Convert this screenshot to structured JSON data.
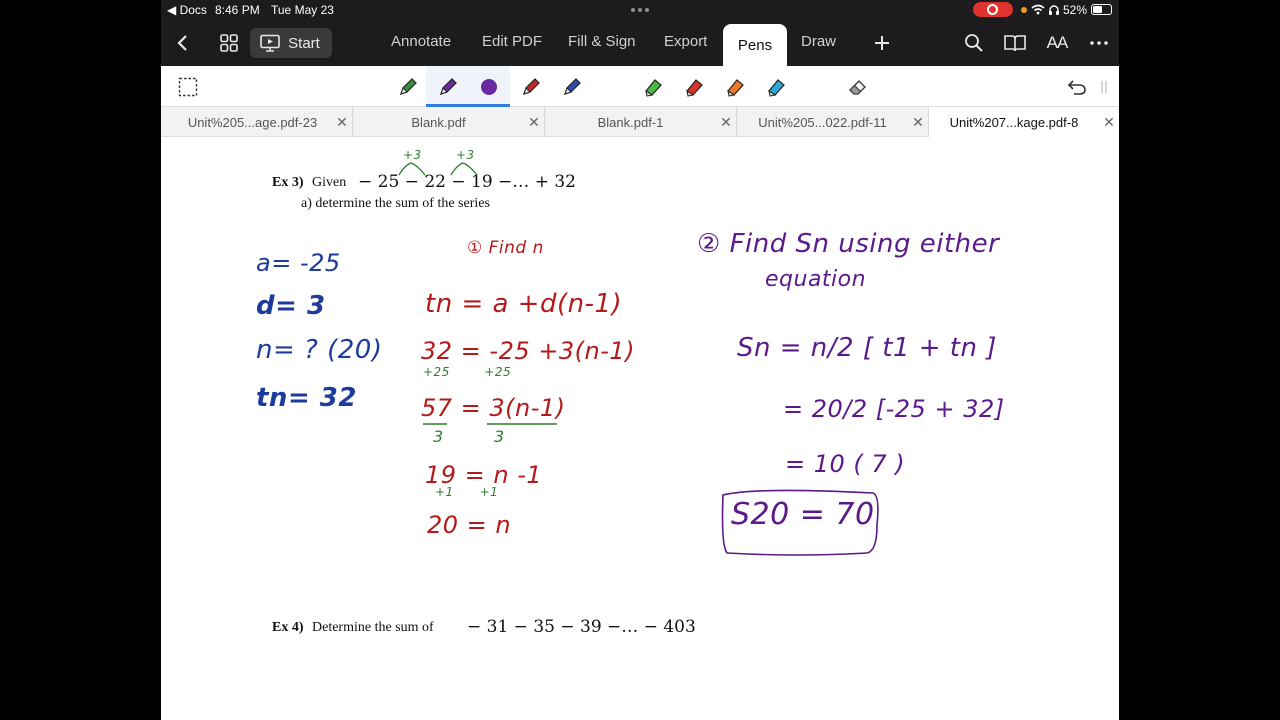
{
  "status_bar": {
    "back_app": "◀ Docs",
    "time": "8:46 PM",
    "date": "Tue May 23",
    "battery": "52%"
  },
  "toolbar": {
    "start_label": "Start",
    "tabs": [
      "Annotate",
      "Edit PDF",
      "Fill & Sign",
      "Export",
      "Pens",
      "Draw"
    ],
    "active_tab": "Pens",
    "text_size_label": "AA"
  },
  "pens": {
    "colors": [
      "#3f8a3a",
      "#6a2aa0",
      "#6a2aa0",
      "#c0282a",
      "#2a4fb0"
    ],
    "highlighters": [
      "#4cb944",
      "#d8342a",
      "#ec7a2a",
      "#2aa8d8"
    ]
  },
  "doc_tabs": [
    {
      "label": "Unit%205...age.pdf-23",
      "active": false
    },
    {
      "label": "Blank.pdf",
      "active": false
    },
    {
      "label": "Blank.pdf-1",
      "active": false
    },
    {
      "label": "Unit%205...022.pdf-11",
      "active": false
    },
    {
      "label": "Unit%207...kage.pdf-8",
      "active": true
    }
  ],
  "document": {
    "ex3_label": "Ex 3)",
    "ex3_given": "Given",
    "ex3_series": "− 25 − 22 − 19 −… + 32",
    "ex3_a": "a)   determine the sum of the series",
    "ex4_label": "Ex 4)",
    "ex4_text": "Determine the sum of",
    "ex4_series": "− 31 − 35 − 39 −… − 403"
  },
  "handwriting": {
    "diff1": "+3",
    "diff2": "+3",
    "a_val": "a= -25",
    "d_val": "d= 3",
    "n_val": "n= ? (20)",
    "tn_val": "tn= 32",
    "step1": "① Find n",
    "eq1": "tn = a +d(n-1)",
    "eq2": "32 = -25 +3(n-1)",
    "eq2_sub": "+25        +25",
    "eq3": "57 = 3(n-1)",
    "eq3_sub": "3         3",
    "eq4": "19 = n -1",
    "eq4_sub": "+1      +1",
    "eq5": "20 = n",
    "step2": "② Find Sn using either",
    "step2b": "equation",
    "sn_formula": "Sn = n/2 [ t1 + tn ]",
    "sn_sub": "= 20/2 [-25 + 32]",
    "sn_mult": "= 10 ( 7 )",
    "sn_result": "S20 = 70"
  }
}
